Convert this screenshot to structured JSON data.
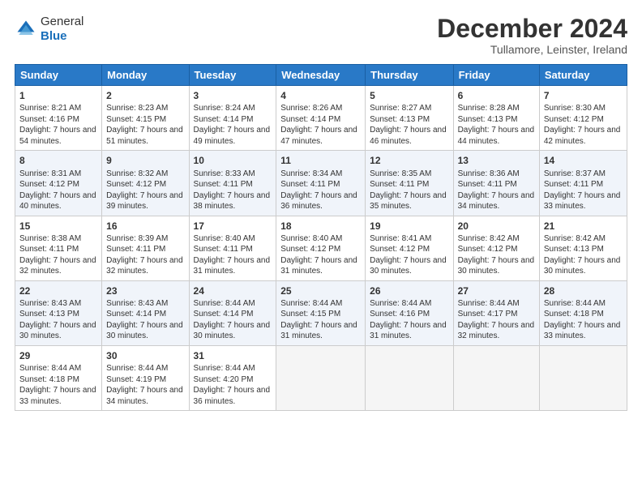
{
  "header": {
    "logo_line1": "General",
    "logo_line2": "Blue",
    "month_title": "December 2024",
    "location": "Tullamore, Leinster, Ireland"
  },
  "days_of_week": [
    "Sunday",
    "Monday",
    "Tuesday",
    "Wednesday",
    "Thursday",
    "Friday",
    "Saturday"
  ],
  "weeks": [
    [
      {
        "day": "1",
        "sunrise": "Sunrise: 8:21 AM",
        "sunset": "Sunset: 4:16 PM",
        "daylight": "Daylight: 7 hours and 54 minutes."
      },
      {
        "day": "2",
        "sunrise": "Sunrise: 8:23 AM",
        "sunset": "Sunset: 4:15 PM",
        "daylight": "Daylight: 7 hours and 51 minutes."
      },
      {
        "day": "3",
        "sunrise": "Sunrise: 8:24 AM",
        "sunset": "Sunset: 4:14 PM",
        "daylight": "Daylight: 7 hours and 49 minutes."
      },
      {
        "day": "4",
        "sunrise": "Sunrise: 8:26 AM",
        "sunset": "Sunset: 4:14 PM",
        "daylight": "Daylight: 7 hours and 47 minutes."
      },
      {
        "day": "5",
        "sunrise": "Sunrise: 8:27 AM",
        "sunset": "Sunset: 4:13 PM",
        "daylight": "Daylight: 7 hours and 46 minutes."
      },
      {
        "day": "6",
        "sunrise": "Sunrise: 8:28 AM",
        "sunset": "Sunset: 4:13 PM",
        "daylight": "Daylight: 7 hours and 44 minutes."
      },
      {
        "day": "7",
        "sunrise": "Sunrise: 8:30 AM",
        "sunset": "Sunset: 4:12 PM",
        "daylight": "Daylight: 7 hours and 42 minutes."
      }
    ],
    [
      {
        "day": "8",
        "sunrise": "Sunrise: 8:31 AM",
        "sunset": "Sunset: 4:12 PM",
        "daylight": "Daylight: 7 hours and 40 minutes."
      },
      {
        "day": "9",
        "sunrise": "Sunrise: 8:32 AM",
        "sunset": "Sunset: 4:12 PM",
        "daylight": "Daylight: 7 hours and 39 minutes."
      },
      {
        "day": "10",
        "sunrise": "Sunrise: 8:33 AM",
        "sunset": "Sunset: 4:11 PM",
        "daylight": "Daylight: 7 hours and 38 minutes."
      },
      {
        "day": "11",
        "sunrise": "Sunrise: 8:34 AM",
        "sunset": "Sunset: 4:11 PM",
        "daylight": "Daylight: 7 hours and 36 minutes."
      },
      {
        "day": "12",
        "sunrise": "Sunrise: 8:35 AM",
        "sunset": "Sunset: 4:11 PM",
        "daylight": "Daylight: 7 hours and 35 minutes."
      },
      {
        "day": "13",
        "sunrise": "Sunrise: 8:36 AM",
        "sunset": "Sunset: 4:11 PM",
        "daylight": "Daylight: 7 hours and 34 minutes."
      },
      {
        "day": "14",
        "sunrise": "Sunrise: 8:37 AM",
        "sunset": "Sunset: 4:11 PM",
        "daylight": "Daylight: 7 hours and 33 minutes."
      }
    ],
    [
      {
        "day": "15",
        "sunrise": "Sunrise: 8:38 AM",
        "sunset": "Sunset: 4:11 PM",
        "daylight": "Daylight: 7 hours and 32 minutes."
      },
      {
        "day": "16",
        "sunrise": "Sunrise: 8:39 AM",
        "sunset": "Sunset: 4:11 PM",
        "daylight": "Daylight: 7 hours and 32 minutes."
      },
      {
        "day": "17",
        "sunrise": "Sunrise: 8:40 AM",
        "sunset": "Sunset: 4:11 PM",
        "daylight": "Daylight: 7 hours and 31 minutes."
      },
      {
        "day": "18",
        "sunrise": "Sunrise: 8:40 AM",
        "sunset": "Sunset: 4:12 PM",
        "daylight": "Daylight: 7 hours and 31 minutes."
      },
      {
        "day": "19",
        "sunrise": "Sunrise: 8:41 AM",
        "sunset": "Sunset: 4:12 PM",
        "daylight": "Daylight: 7 hours and 30 minutes."
      },
      {
        "day": "20",
        "sunrise": "Sunrise: 8:42 AM",
        "sunset": "Sunset: 4:12 PM",
        "daylight": "Daylight: 7 hours and 30 minutes."
      },
      {
        "day": "21",
        "sunrise": "Sunrise: 8:42 AM",
        "sunset": "Sunset: 4:13 PM",
        "daylight": "Daylight: 7 hours and 30 minutes."
      }
    ],
    [
      {
        "day": "22",
        "sunrise": "Sunrise: 8:43 AM",
        "sunset": "Sunset: 4:13 PM",
        "daylight": "Daylight: 7 hours and 30 minutes."
      },
      {
        "day": "23",
        "sunrise": "Sunrise: 8:43 AM",
        "sunset": "Sunset: 4:14 PM",
        "daylight": "Daylight: 7 hours and 30 minutes."
      },
      {
        "day": "24",
        "sunrise": "Sunrise: 8:44 AM",
        "sunset": "Sunset: 4:14 PM",
        "daylight": "Daylight: 7 hours and 30 minutes."
      },
      {
        "day": "25",
        "sunrise": "Sunrise: 8:44 AM",
        "sunset": "Sunset: 4:15 PM",
        "daylight": "Daylight: 7 hours and 31 minutes."
      },
      {
        "day": "26",
        "sunrise": "Sunrise: 8:44 AM",
        "sunset": "Sunset: 4:16 PM",
        "daylight": "Daylight: 7 hours and 31 minutes."
      },
      {
        "day": "27",
        "sunrise": "Sunrise: 8:44 AM",
        "sunset": "Sunset: 4:17 PM",
        "daylight": "Daylight: 7 hours and 32 minutes."
      },
      {
        "day": "28",
        "sunrise": "Sunrise: 8:44 AM",
        "sunset": "Sunset: 4:18 PM",
        "daylight": "Daylight: 7 hours and 33 minutes."
      }
    ],
    [
      {
        "day": "29",
        "sunrise": "Sunrise: 8:44 AM",
        "sunset": "Sunset: 4:18 PM",
        "daylight": "Daylight: 7 hours and 33 minutes."
      },
      {
        "day": "30",
        "sunrise": "Sunrise: 8:44 AM",
        "sunset": "Sunset: 4:19 PM",
        "daylight": "Daylight: 7 hours and 34 minutes."
      },
      {
        "day": "31",
        "sunrise": "Sunrise: 8:44 AM",
        "sunset": "Sunset: 4:20 PM",
        "daylight": "Daylight: 7 hours and 36 minutes."
      },
      {
        "day": "",
        "sunrise": "",
        "sunset": "",
        "daylight": ""
      },
      {
        "day": "",
        "sunrise": "",
        "sunset": "",
        "daylight": ""
      },
      {
        "day": "",
        "sunrise": "",
        "sunset": "",
        "daylight": ""
      },
      {
        "day": "",
        "sunrise": "",
        "sunset": "",
        "daylight": ""
      }
    ]
  ]
}
